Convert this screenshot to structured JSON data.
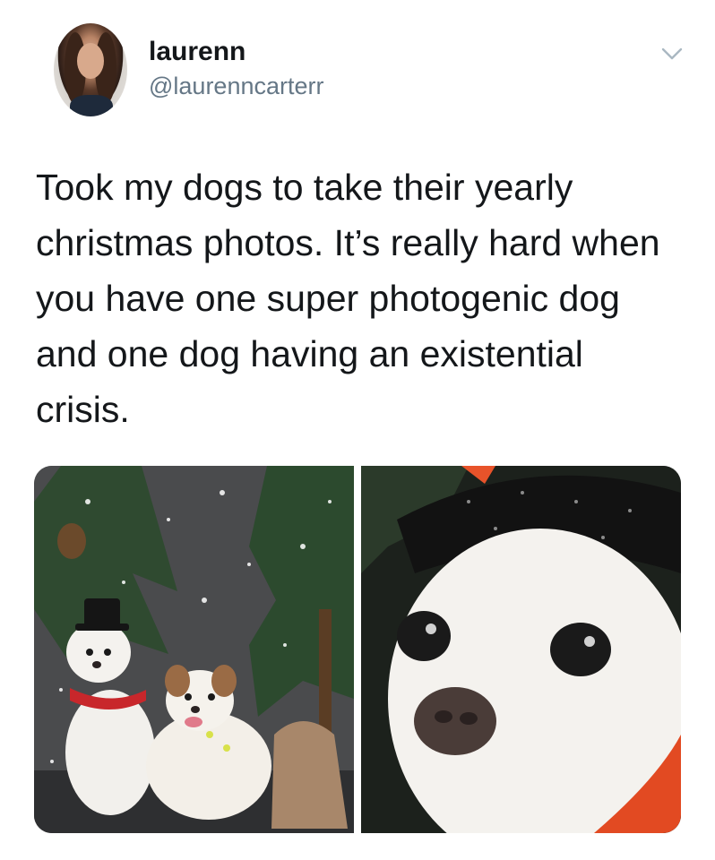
{
  "user": {
    "display_name": "laurenn",
    "handle": "@laurenncarterr",
    "avatar_icon": "profile-photo"
  },
  "menu": {
    "caret_icon": "chevron-down-icon",
    "color": "#aab8c2"
  },
  "tweet": {
    "text": "Took my dogs to take their yearly\nchristmas photos. It’s really hard when\nyou have one super photogenic dog\nand one dog having an existential\ncrisis."
  },
  "media": {
    "photos": [
      {
        "icon": "two-dogs-christmas-photo"
      },
      {
        "icon": "dog-closeup-photo"
      }
    ]
  },
  "colors": {
    "text": "#14171a",
    "secondary": "#657786",
    "background": "#ffffff"
  }
}
